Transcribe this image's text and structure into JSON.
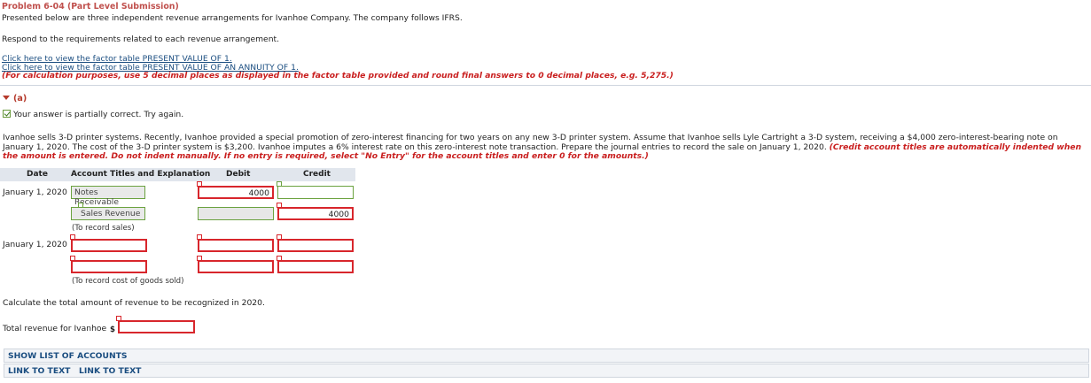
{
  "problem": {
    "title": "Problem 6-04 (Part Level Submission)",
    "intro": "Presented below are three independent revenue arrangements for Ivanhoe Company. The company follows IFRS.",
    "respond": "Respond to the requirements related to each revenue arrangement."
  },
  "links": {
    "pv1": "Click here to view the factor table PRESENT VALUE OF 1.",
    "pva": "Click here to view the factor table PRESENT VALUE OF AN ANNUITY OF 1.",
    "note": "(For calculation purposes, use 5 decimal places as displayed in the factor table provided and round final answers to 0 decimal places, e.g. 5,275.)"
  },
  "part": {
    "label": "(a)",
    "status": "Your answer is partially correct.  Try again.",
    "question": "Ivanhoe sells 3-D printer systems. Recently, Ivanhoe provided a special promotion of zero-interest financing for two years on any new 3-D printer system. Assume that Ivanhoe sells Lyle Cartright a 3-D system, receiving a $4,000 zero-interest-bearing note on January 1, 2020. The cost of the 3-D printer system is $3,200. Ivanhoe imputes a 6% interest rate on this zero-interest note transaction. Prepare the journal entries to record the sale on January 1, 2020. ",
    "instruction": "(Credit account titles are automatically indented when the amount is entered. Do not indent manually. If no entry is required, select \"No Entry\" for the account titles and enter 0 for the amounts.)"
  },
  "table": {
    "headers": {
      "date": "Date",
      "account": "Account Titles and Explanation",
      "debit": "Debit",
      "credit": "Credit"
    },
    "entry1": {
      "date": "January 1, 2020",
      "row1_account": "Notes Receivable",
      "row1_debit": "4000",
      "row1_credit": "",
      "row2_account": "Sales Revenue",
      "row2_debit": "",
      "row2_credit": "4000",
      "memo": "(To record sales)"
    },
    "entry2": {
      "date": "January 1, 2020",
      "memo": "(To record cost of goods sold)"
    }
  },
  "calc": {
    "prompt": "Calculate the total amount of revenue to be recognized in 2020.",
    "label": "Total revenue for Ivanhoe",
    "currency": "$",
    "value": ""
  },
  "footer": {
    "show_accounts": "SHOW LIST OF ACCOUNTS",
    "link1": "LINK TO TEXT",
    "link2": "LINK TO TEXT"
  }
}
